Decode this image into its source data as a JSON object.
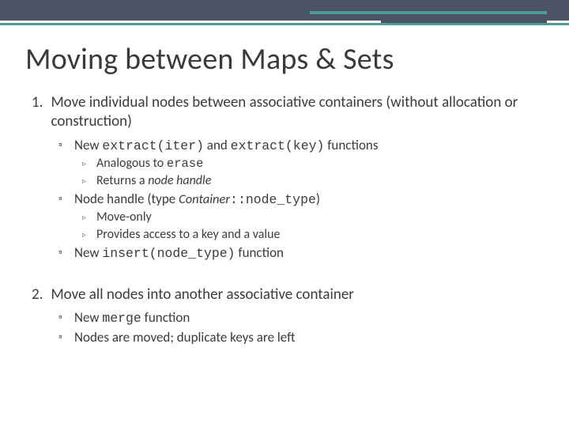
{
  "title": "Moving between Maps & Sets",
  "points": [
    {
      "num": "1.",
      "text": "Move individual nodes between associative containers (without allocation or construction)",
      "sub": [
        {
          "prefix": "New ",
          "code1": "extract(iter)",
          "middle": " and ",
          "code2": "extract(key)",
          "suffix": " functions",
          "sub": [
            {
              "prefix": "Analogous to ",
              "code1": "erase"
            },
            {
              "prefix": "Returns a ",
              "ital": "node handle"
            }
          ]
        },
        {
          "prefix": "Node handle (type ",
          "ital": "Container",
          "code1": "::node_type",
          "suffix": ")",
          "sub": [
            {
              "prefix": "Move-only"
            },
            {
              "prefix": "Provides access to a key and a value"
            }
          ]
        },
        {
          "prefix": "New ",
          "code1": "insert(node_type)",
          "suffix": " function"
        }
      ]
    },
    {
      "num": "2.",
      "text": "Move all nodes into another associative container",
      "sub": [
        {
          "prefix": "New ",
          "code1": "merge",
          "suffix": " function"
        },
        {
          "prefix": "Nodes are moved; duplicate keys are left"
        }
      ]
    }
  ],
  "bullets": {
    "sub1": "▫",
    "sub2": "▹"
  }
}
